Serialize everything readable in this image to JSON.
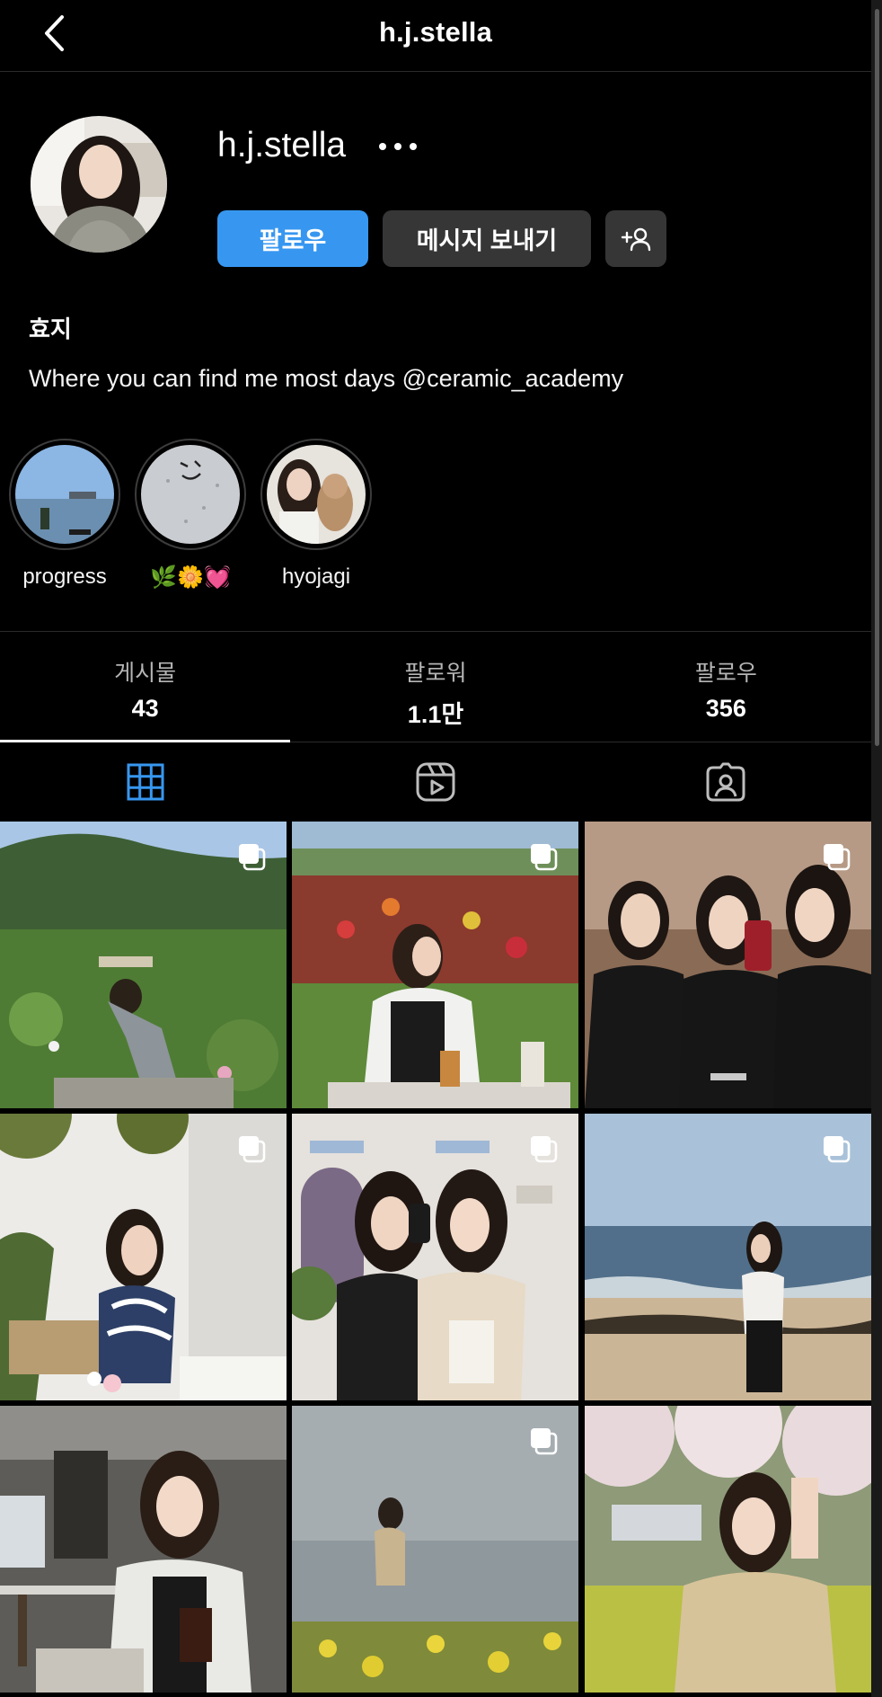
{
  "header": {
    "title": "h.j.stella",
    "back_icon": "chevron-left-icon"
  },
  "profile": {
    "username": "h.j.stella",
    "more_icon": "more-horizontal-icon",
    "follow_label": "팔로우",
    "message_label": "메시지 보내기",
    "add_user_icon": "add-person-icon",
    "full_name": "효지",
    "bio": "Where you can find me most days @ceramic_academy"
  },
  "highlights": [
    {
      "label": "progress"
    },
    {
      "label": "🌿🌼💓"
    },
    {
      "label": "hyojagi"
    }
  ],
  "stats": [
    {
      "label": "게시물",
      "value": "43"
    },
    {
      "label": "팔로워",
      "value": "1.1만"
    },
    {
      "label": "팔로우",
      "value": "356"
    }
  ],
  "tabs": [
    {
      "icon": "grid-icon",
      "active": true
    },
    {
      "icon": "reels-icon",
      "active": false
    },
    {
      "icon": "tagged-icon",
      "active": false
    }
  ],
  "colors": {
    "accent": "#3797f0",
    "button_dark": "#363636",
    "background": "#000000"
  }
}
